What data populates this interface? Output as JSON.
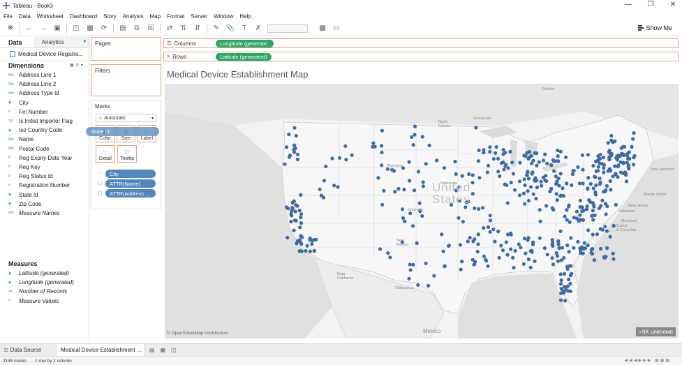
{
  "window": {
    "title": "Tableau - Book3"
  },
  "menu": [
    "File",
    "Data",
    "Worksheet",
    "Dashboard",
    "Story",
    "Analysis",
    "Map",
    "Format",
    "Server",
    "Window",
    "Help"
  ],
  "toolbar": {
    "show_me": "Show Me"
  },
  "data_pane": {
    "tab_data": "Data",
    "tab_analytics": "Analytics",
    "datasource": "Medical Device Registra...",
    "dimensions_title": "Dimensions",
    "dimensions": [
      {
        "label": "Address Line 1",
        "type": "Abc"
      },
      {
        "label": "Address Line 2",
        "type": "Abc"
      },
      {
        "label": "Address Type Id",
        "type": "Abc"
      },
      {
        "label": "City",
        "type": "geo"
      },
      {
        "label": "Fei Number",
        "type": "#"
      },
      {
        "label": "Is Initial Importer Flag",
        "type": "T|F"
      },
      {
        "label": "Iso Country Code",
        "type": "geo"
      },
      {
        "label": "Name",
        "type": "Abc"
      },
      {
        "label": "Postal Code",
        "type": "Abc"
      },
      {
        "label": "Reg Expiry Date Year",
        "type": "#"
      },
      {
        "label": "Reg Key",
        "type": "#"
      },
      {
        "label": "Reg Status Id",
        "type": "#"
      },
      {
        "label": "Registration Number",
        "type": "#"
      },
      {
        "label": "State Id",
        "type": "geo"
      },
      {
        "label": "Zip Code",
        "type": "geo"
      },
      {
        "label": "Measure Names",
        "type": "Abc"
      }
    ],
    "measures_title": "Measures",
    "measures": [
      {
        "label": "Latitude (generated)",
        "type": "geo"
      },
      {
        "label": "Longitude (generated)",
        "type": "geo"
      },
      {
        "label": "Number of Records",
        "type": "=#"
      },
      {
        "label": "Measure Values",
        "type": "#"
      }
    ]
  },
  "shelves": {
    "pages": "Pages",
    "filters": "Filters",
    "marks": "Marks",
    "mark_type": "Automatic",
    "mark_buttons": [
      "Color",
      "Size",
      "Label",
      "Detail",
      "Tooltip"
    ],
    "drag_pill": "State Id",
    "mark_pills": [
      "City",
      "ATTR(Name)",
      "ATTR(Address ..."
    ],
    "columns_label": "Columns",
    "columns_pill": "Longitude (generate..",
    "rows_label": "Rows",
    "rows_pill": "Latitude (generated)"
  },
  "viz": {
    "title": "Medical Device Establishment Map",
    "attribution": "© OpenStreetMap contributors",
    "unknown_badge": ">9K unknown",
    "labels": {
      "ontario": "Ontario",
      "north_dakota": "North\nDakota",
      "minnesota": "Minnesota",
      "wyoming": "Wyoming",
      "nebraska": "Nebraska",
      "colorado": "Colorado",
      "new_mexico": "New\nMexico",
      "united_states": "United\nStates",
      "baja_california": "Baja\nCalifornia",
      "chihuahua": "Chihuahua",
      "mexico": "Mexico",
      "new_hampshire": "New Hampshi",
      "rhode_island": "Rhode Island",
      "new_jersey": "New Jersey",
      "delaware": "Delaware",
      "maryland": "Maryland",
      "district_of_columbia": "District\nof Columbia"
    },
    "mark_color": "#3d6aa5"
  },
  "tabs": {
    "data_source": "Data Source",
    "sheet": "Medical Device Establishment ..."
  },
  "status": {
    "marks": "2148 marks",
    "rows_cols": "1 row by 1 column"
  }
}
